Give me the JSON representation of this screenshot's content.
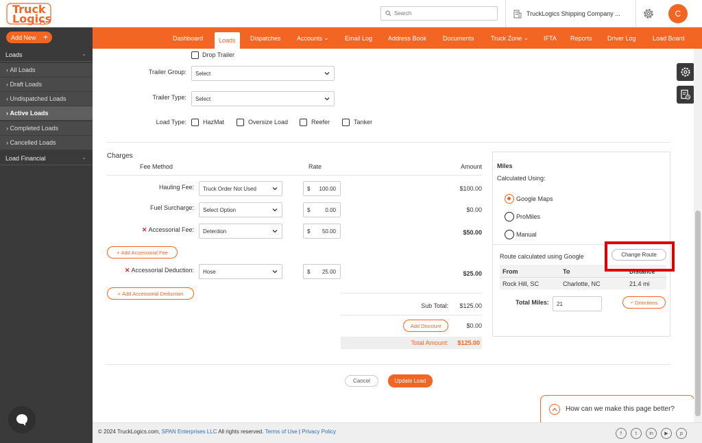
{
  "brand": {
    "logo_line1": "Truck",
    "logo_line2": "Logics"
  },
  "header": {
    "search_placeholder": "Search",
    "company": "TruckLogics Shipping Company ...",
    "avatar_letter": "C"
  },
  "sidebar": {
    "add_new": "Add New",
    "loads_section": "Loads",
    "items": [
      "All Loads",
      "Draft Loads",
      "Undispatched Loads",
      "Active Loads",
      "Completed Loads",
      "Cancelled Loads"
    ],
    "financial_section": "Load Financial"
  },
  "nav": {
    "items": [
      "Dashboard",
      "Loads",
      "Dispatches",
      "Accounts",
      "Email Log",
      "Address Book",
      "Documents",
      "Truck Zone",
      "IFTA",
      "Reports",
      "Driver Log",
      "Load Board"
    ]
  },
  "trailer": {
    "drop_trailer": "Drop Trailer",
    "group_label": "Trailer Group:",
    "group_value": "Select",
    "type_label": "Trailer Type:",
    "type_value": "Select",
    "load_type_label": "Load Type:",
    "load_types": [
      "HazMat",
      "Oversize Load",
      "Reefer",
      "Tanker"
    ]
  },
  "charges": {
    "title": "Charges",
    "col_fee_method": "Fee Method",
    "col_rate": "Rate",
    "col_amount": "Amount",
    "currency": "$",
    "rows": [
      {
        "label": "Hauling Fee:",
        "method": "Truck Order Not Used",
        "rate": "100.00",
        "amount": "$100.00"
      },
      {
        "label": "Fuel Surcharge:",
        "method": "Select Option",
        "rate": "0.00",
        "amount": "$0.00"
      },
      {
        "label": "Accessorial Fee:",
        "method": "Detention",
        "rate": "50.00",
        "amount": "$50.00"
      },
      {
        "label": "Accessorial Deduction:",
        "method": "Hose",
        "rate": "25.00",
        "amount": "$25.00"
      }
    ],
    "add_fee": "Add Accessorial Fee",
    "add_deduction": "Add Accessorial Deduction",
    "subtotal_label": "Sub Total:",
    "subtotal_value": "$125.00",
    "add_discount": "Add Discount",
    "discount_value": "$0.00",
    "total_label": "Total Amount:",
    "total_value": "$125.00"
  },
  "miles": {
    "title": "Miles",
    "calc_using": "Calculated Using:",
    "options": [
      "Google Maps",
      "ProMiles",
      "Manual"
    ],
    "selected": "Google Maps",
    "route_note": "Route calculated using Google",
    "change_route": "Change Route",
    "col_from": "From",
    "col_to": "To",
    "col_distance": "Distance",
    "from": "Rock Hill, SC",
    "to": "Charlotte, NC",
    "distance": "21.4 mi",
    "total_label": "Total Miles:",
    "total_value": "21",
    "directions": "Directions"
  },
  "actions": {
    "cancel": "Cancel",
    "update": "Update Load"
  },
  "feedback": {
    "text": "How can we make this page better?"
  },
  "footer": {
    "copyright": "© 2024 TruckLogics.com,",
    "span": "SPAN Enterprises LLC",
    "rights": "All rights reserved.",
    "terms": "Terms of Use",
    "sep": "|",
    "privacy": "Privacy Policy",
    "social": [
      "f",
      "t",
      "in",
      "▶",
      "p"
    ]
  },
  "colors": {
    "accent": "#f26522",
    "sidebar": "#3a3a3a",
    "highlight": "#e10000"
  }
}
